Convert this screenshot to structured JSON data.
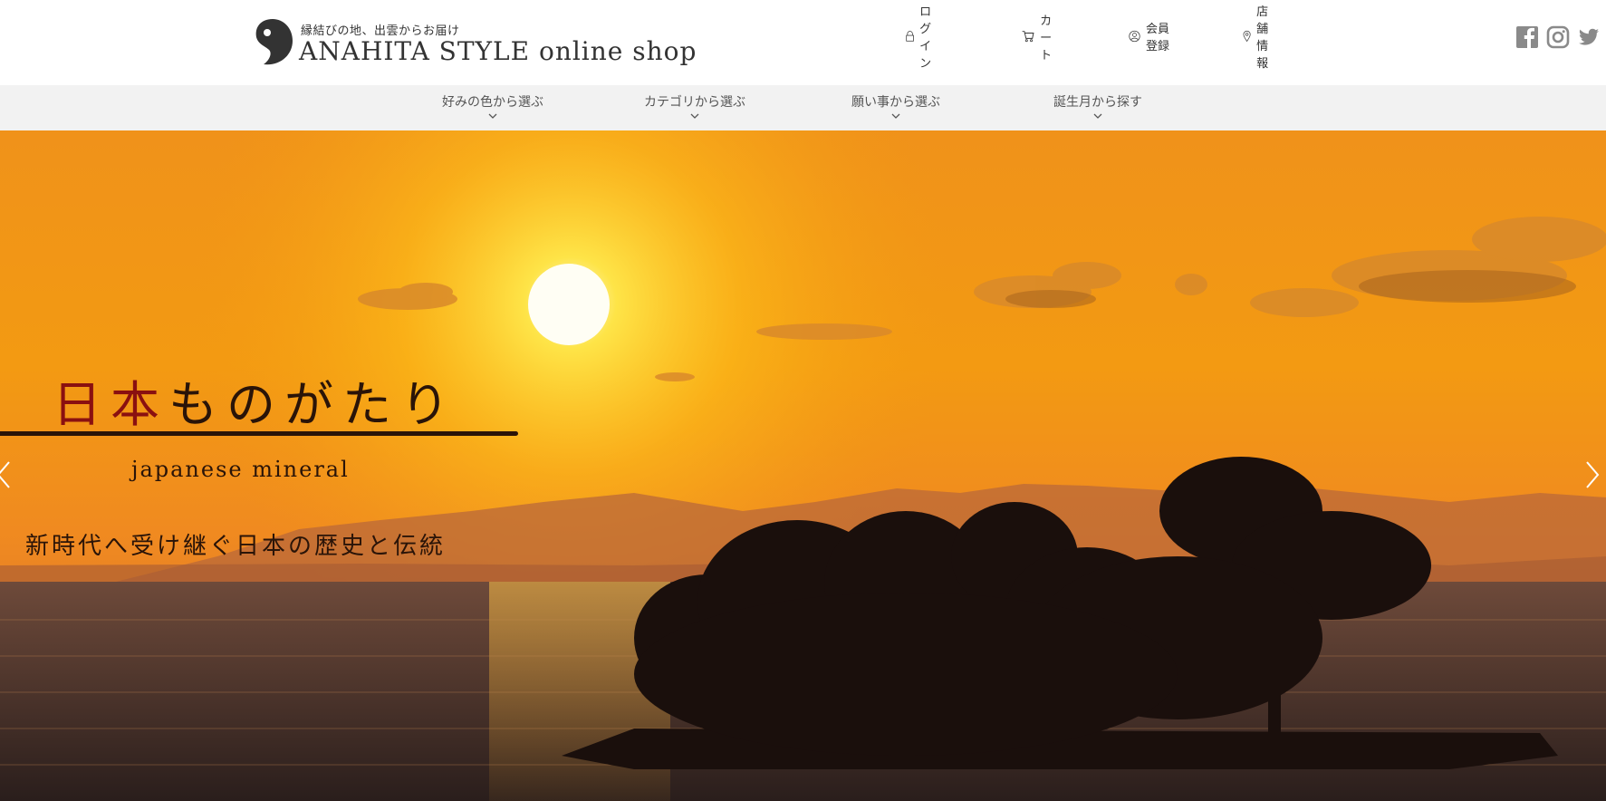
{
  "header": {
    "tagline": "縁結びの地、出雲からお届け",
    "brand": "ANAHITA STYLE  online shop",
    "links": {
      "login": "ログイン",
      "cart": "カート",
      "register": "会員登録",
      "store": "店舗情報"
    },
    "social": [
      "facebook-icon",
      "instagram-icon",
      "twitter-icon"
    ]
  },
  "nav": {
    "items": [
      {
        "label": "好みの色から選ぶ"
      },
      {
        "label": "カテゴリから選ぶ"
      },
      {
        "label": "願い事から選ぶ"
      },
      {
        "label": "誕生月から探す"
      }
    ]
  },
  "hero": {
    "title_red": "日本",
    "title_rest": "ものがたり",
    "subtitle": "japanese mineral",
    "caption": "新時代へ受け継ぐ日本の歴史と伝統"
  },
  "colors": {
    "accent_red": "#8a1010",
    "text_dark": "#333333",
    "nav_bg": "#f2f2f2"
  }
}
